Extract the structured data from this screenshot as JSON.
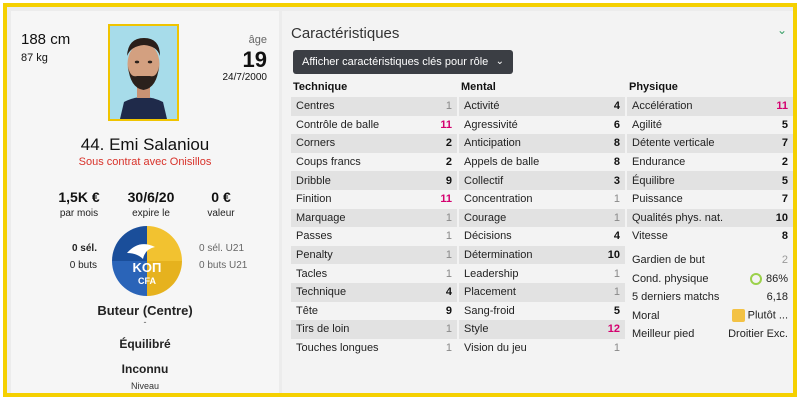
{
  "player": {
    "height": "188 cm",
    "weight": "87 kg",
    "age_label": "âge",
    "age": "19",
    "birthdate": "24/7/2000",
    "name": "44. Emi Salaniou",
    "contract_status": "Sous contrat avec Onisillos",
    "wage": "1,5K €",
    "wage_label": "par mois",
    "expiry": "30/6/20",
    "expiry_label": "expire le",
    "value": "0 €",
    "value_label": "valeur",
    "selections": "0 sél.",
    "goals": "0 buts",
    "u21_selections": "0 sél. U21",
    "u21_goals": "0 buts U21",
    "club_logo_text": "KOΠ",
    "club_logo_sub": "CFA",
    "role": "Buteur (Centre)",
    "role_sub": "-",
    "balance": "Équilibré",
    "level": "Inconnu",
    "level_label": "Niveau"
  },
  "attributes": {
    "title": "Caractéristiques",
    "dropdown_label": "Afficher caractéristiques clés pour rôle",
    "technique": {
      "header": "Technique",
      "rows": [
        {
          "label": "Centres",
          "value": "1"
        },
        {
          "label": "Contrôle de balle",
          "value": "11"
        },
        {
          "label": "Corners",
          "value": "2"
        },
        {
          "label": "Coups francs",
          "value": "2"
        },
        {
          "label": "Dribble",
          "value": "9"
        },
        {
          "label": "Finition",
          "value": "11"
        },
        {
          "label": "Marquage",
          "value": "1"
        },
        {
          "label": "Passes",
          "value": "1"
        },
        {
          "label": "Penalty",
          "value": "1"
        },
        {
          "label": "Tacles",
          "value": "1"
        },
        {
          "label": "Technique",
          "value": "4"
        },
        {
          "label": "Tête",
          "value": "9"
        },
        {
          "label": "Tirs de loin",
          "value": "1"
        },
        {
          "label": "Touches longues",
          "value": "1"
        }
      ]
    },
    "mental": {
      "header": "Mental",
      "rows": [
        {
          "label": "Activité",
          "value": "4"
        },
        {
          "label": "Agressivité",
          "value": "6"
        },
        {
          "label": "Anticipation",
          "value": "8"
        },
        {
          "label": "Appels de balle",
          "value": "8"
        },
        {
          "label": "Collectif",
          "value": "3"
        },
        {
          "label": "Concentration",
          "value": "1"
        },
        {
          "label": "Courage",
          "value": "1"
        },
        {
          "label": "Décisions",
          "value": "4"
        },
        {
          "label": "Détermination",
          "value": "10"
        },
        {
          "label": "Leadership",
          "value": "1"
        },
        {
          "label": "Placement",
          "value": "1"
        },
        {
          "label": "Sang-froid",
          "value": "5"
        },
        {
          "label": "Style",
          "value": "12"
        },
        {
          "label": "Vision du jeu",
          "value": "1"
        }
      ]
    },
    "physique": {
      "header": "Physique",
      "rows": [
        {
          "label": "Accélération",
          "value": "11"
        },
        {
          "label": "Agilité",
          "value": "5"
        },
        {
          "label": "Détente verticale",
          "value": "7"
        },
        {
          "label": "Endurance",
          "value": "2"
        },
        {
          "label": "Équilibre",
          "value": "5"
        },
        {
          "label": "Puissance",
          "value": "7"
        },
        {
          "label": "Qualités phys. nat.",
          "value": "10"
        },
        {
          "label": "Vitesse",
          "value": "8"
        }
      ],
      "goalkeeper_label": "Gardien de but",
      "goalkeeper_value": "2",
      "condition_label": "Cond. physique",
      "condition_value": "86%",
      "last5_label": "5 derniers matchs",
      "last5_value": "6,18",
      "morale_label": "Moral",
      "morale_value": "Plutôt ...",
      "foot_label": "Meilleur pied",
      "foot_value": "Droitier Exc."
    }
  },
  "colors": {
    "frame": "#f5d000",
    "high_value": "#d4006f",
    "contract": "#d8322a",
    "condition_ring": "#9bd14a",
    "morale_icon": "#f3c244"
  }
}
